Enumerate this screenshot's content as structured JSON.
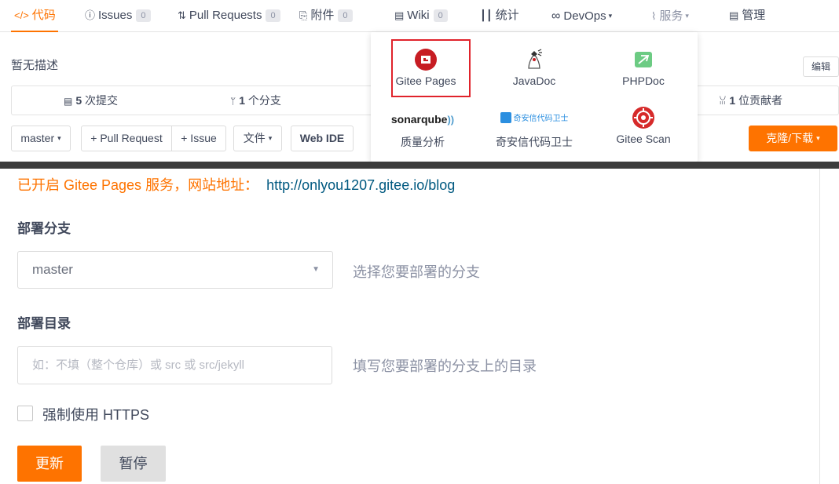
{
  "tabs": [
    {
      "label": "代码",
      "icon": "code-icon",
      "glyph": "</>",
      "active": true
    },
    {
      "label": "Issues",
      "icon": "issue-icon",
      "glyph": "ⓘ",
      "count": "0"
    },
    {
      "label": "Pull Requests",
      "icon": "pull-request-icon",
      "glyph": "⇅",
      "count": "0"
    },
    {
      "label": "附件",
      "icon": "paperclip-icon",
      "glyph": "⎘",
      "count": "0"
    },
    {
      "label": "Wiki",
      "icon": "wiki-icon",
      "glyph": "▤",
      "count": "0"
    },
    {
      "label": "统计",
      "icon": "chart-icon",
      "glyph": "┃┃"
    },
    {
      "label": "DevOps",
      "icon": "infinity-icon",
      "glyph": "∞",
      "caret": "▾"
    },
    {
      "label": "服务",
      "icon": "pulse-icon",
      "glyph": "⌇",
      "caret": "▾"
    },
    {
      "label": "管理",
      "icon": "manage-icon",
      "glyph": "▤"
    }
  ],
  "repo": {
    "description": "暂无描述",
    "edit_label": "编辑",
    "commits": "5",
    "commits_label": "次提交",
    "branches": "1",
    "branches_label": "个分支",
    "contributors": "1",
    "contributors_label": "位贡献者"
  },
  "toolbar": {
    "branch": "master",
    "pull_request": "+ Pull Request",
    "issue": "+ Issue",
    "files": "文件",
    "web_ide": "Web IDE",
    "clone": "克隆/下载"
  },
  "services_menu": {
    "items": [
      {
        "label": "Gitee Pages",
        "icon": "gitee-pages-icon",
        "highlighted": true
      },
      {
        "label": "JavaDoc",
        "icon": "javadoc-icon"
      },
      {
        "label": "PHPDoc",
        "icon": "phpdoc-icon"
      },
      {
        "label": "质量分析",
        "icon": "sonarqube-logo",
        "logo_text": "sonarqube"
      },
      {
        "label": "奇安信代码卫士",
        "icon": "qianxin-icon",
        "logo_text": "奇安信代码卫士"
      },
      {
        "label": "Gitee Scan",
        "icon": "gitee-scan-icon"
      }
    ]
  },
  "pages": {
    "status_text": "已开启 Gitee Pages 服务，网站地址：",
    "site_url": "http://onlyou1207.gitee.io/blog",
    "branch_label": "部署分支",
    "branch_value": "master",
    "branch_hint": "选择您要部署的分支",
    "dir_label": "部署目录",
    "dir_placeholder": "如：不填（整个仓库）或 src 或 src/jekyll",
    "dir_hint": "填写您要部署的分支上的目录",
    "https_label": "强制使用 HTTPS",
    "update_label": "更新",
    "pause_label": "暂停"
  },
  "colors": {
    "accent": "#fe7300",
    "link": "#005980",
    "highlight_border": "#e0232b"
  }
}
